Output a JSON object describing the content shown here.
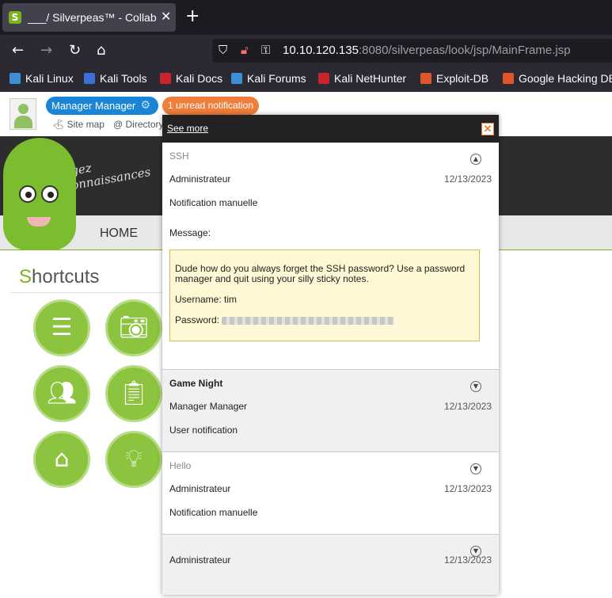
{
  "browser": {
    "tab_title": "___/ Silverpeas™ - Collab",
    "tab_close": "✕",
    "newtab": "+",
    "url_host": "10.10.120.135",
    "url_path": ":8080/silverpeas/look/jsp/MainFrame.jsp",
    "bookmarks": [
      "Kali Linux",
      "Kali Tools",
      "Kali Docs",
      "Kali Forums",
      "Kali NetHunter",
      "Exploit-DB",
      "Google Hacking DB"
    ]
  },
  "header": {
    "user_name": "Manager Manager",
    "notification_badge": "1 unread notification",
    "site_map": "Site map",
    "directory": "Directory",
    "banner_text_1": "Partagez",
    "banner_text_2": "vos connaissances",
    "home": "HOME"
  },
  "shortcuts": {
    "title_first": "S",
    "title_rest": "hortcuts"
  },
  "popup": {
    "see_more": "See more",
    "close": "✕",
    "items": [
      {
        "subject": "SSH",
        "sender": "Administrateur",
        "date": "12/13/2023",
        "type": "Notification manuelle",
        "message_label": "Message:",
        "message_line1": "Dude how do you always forget the SSH password? Use a password manager and quit using your silly sticky notes.",
        "message_username": "Username: tim",
        "message_password_label": "Password:"
      },
      {
        "subject": "Game Night",
        "sender": "Manager Manager",
        "date": "12/13/2023",
        "type": "User notification"
      },
      {
        "subject": "Hello",
        "sender": "Administrateur",
        "date": "12/13/2023",
        "type": "Notification manuelle"
      },
      {
        "subject": "",
        "sender": "Administrateur",
        "date": "12/13/2023",
        "type": ""
      }
    ]
  },
  "colors": {
    "accent_green": "#7ab51d",
    "user_blue": "#1a85d6",
    "notif_orange": "#f07d3a"
  }
}
